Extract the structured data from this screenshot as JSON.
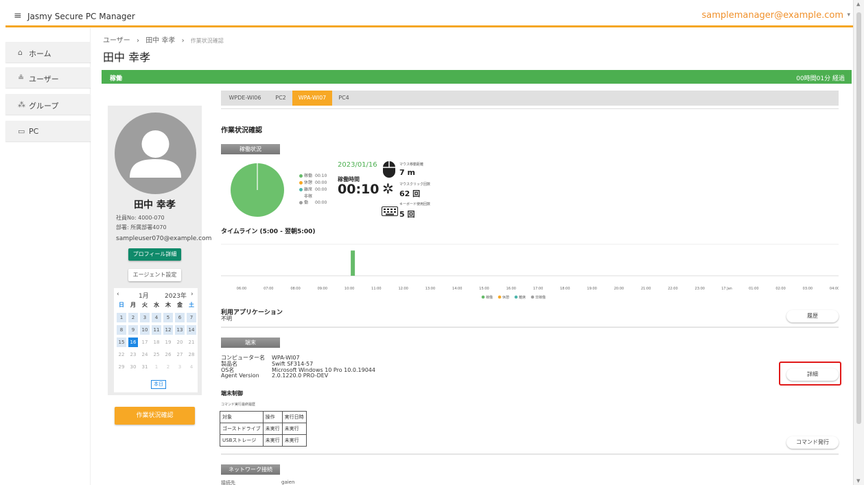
{
  "header": {
    "menu_icon": "hamburger-icon",
    "app_title": "Jasmy Secure PC Manager",
    "user_email": "samplemanager@example.com",
    "caret": "▾"
  },
  "sidebar": {
    "items": [
      {
        "icon": "home-icon",
        "label": "ホーム"
      },
      {
        "icon": "user-icon",
        "label": "ユーザー"
      },
      {
        "icon": "group-icon",
        "label": "グループ"
      },
      {
        "icon": "pc-icon",
        "label": "PC"
      }
    ]
  },
  "breadcrumb": {
    "root": "ユーザー",
    "sep": "›",
    "user": "田中 幸孝",
    "current": "作業状況確認"
  },
  "page_title": "田中 幸孝",
  "status": {
    "state": "稼働",
    "elapsed": "00時間01分 経過",
    "color": "#4caf50"
  },
  "profile": {
    "name": "田中 幸孝",
    "employee_no": "社員No: 4000-070",
    "department": "部署: 所属部署4070",
    "email": "sampleuser070@example.com",
    "profile_button": "プロフィール詳細",
    "agent_button": "エージェント設定"
  },
  "calendar": {
    "prev": "‹",
    "next": "›",
    "month": "1月",
    "year": "2023年",
    "dow": [
      "日",
      "月",
      "火",
      "水",
      "木",
      "金",
      "土"
    ],
    "weeks": [
      [
        "1",
        "2",
        "3",
        "4",
        "5",
        "6",
        "7"
      ],
      [
        "8",
        "9",
        "10",
        "11",
        "12",
        "13",
        "14"
      ],
      [
        "15",
        "16",
        "17",
        "18",
        "19",
        "20",
        "21"
      ],
      [
        "22",
        "23",
        "24",
        "25",
        "26",
        "27",
        "28"
      ],
      [
        "29",
        "30",
        "31",
        "1",
        "2",
        "3",
        "4"
      ]
    ],
    "today_label": "本日"
  },
  "work_status_button": "作業状況確認",
  "tabs": [
    "WPDE-WI06",
    "PC2",
    "WPA-WI07",
    "PC4"
  ],
  "active_tab": 2,
  "work": {
    "title": "作業状況確認",
    "operation_label": "稼働状況",
    "legend": [
      {
        "label": "稼働",
        "value": "00:10",
        "color": "#66bb6a"
      },
      {
        "label": "休憩",
        "value": "00:00",
        "color": "#f7a825"
      },
      {
        "label": "離席",
        "value": "00:00",
        "color": "#4db6ac"
      },
      {
        "label": "非稼働",
        "value": "00:00",
        "color": "#9e9e9e"
      }
    ],
    "date": "2023/01/16",
    "uptime_label": "稼働時間",
    "uptime": "00:10",
    "mouse_move_label": "マウス移動距離",
    "mouse_move": "7 m",
    "mouse_click_label": "マウスクリック回数",
    "mouse_click": "62 回",
    "keyboard_label": "キーボード使用回数",
    "keyboard": "5 回"
  },
  "chart_data": {
    "type": "bar",
    "title": "タイムライン (5:00 - 翌朝5:00)",
    "categories": [
      "06:00",
      "07:00",
      "08:00",
      "09:00",
      "10:00",
      "11:00",
      "12:00",
      "13:00",
      "14:00",
      "15:00",
      "16:00",
      "17:00",
      "18:00",
      "19:00",
      "20:00",
      "21:00",
      "22:00",
      "23:00",
      "17 Jan",
      "01:00",
      "02:00",
      "03:00",
      "04:00"
    ],
    "series": [
      {
        "name": "稼働",
        "values": [
          0,
          0,
          0,
          0,
          0.8,
          0,
          0,
          0,
          0,
          0,
          0,
          0,
          0,
          0,
          0,
          0,
          0,
          0,
          0,
          0,
          0,
          0,
          0
        ]
      },
      {
        "name": "休憩",
        "values": [
          0,
          0,
          0,
          0,
          0,
          0,
          0,
          0,
          0,
          0,
          0,
          0,
          0,
          0,
          0,
          0,
          0,
          0,
          0,
          0,
          0,
          0,
          0
        ]
      },
      {
        "name": "離席",
        "values": [
          0,
          0,
          0,
          0,
          0,
          0,
          0,
          0,
          0,
          0,
          0,
          0,
          0,
          0,
          0,
          0,
          0,
          0,
          0,
          0,
          0,
          0,
          0
        ]
      },
      {
        "name": "非稼働",
        "values": [
          0,
          0,
          0,
          0,
          0,
          0,
          0,
          0,
          0,
          0,
          0,
          0,
          0,
          0,
          0,
          0,
          0,
          0,
          0,
          0,
          0,
          0,
          0
        ]
      }
    ],
    "pie": [
      {
        "label": "稼働",
        "value": 100
      }
    ],
    "ylim": [
      0,
      1
    ]
  },
  "apps": {
    "title": "利用アプリケーション",
    "value": "不明",
    "history_button": "履歴"
  },
  "terminal": {
    "label": "端末",
    "rows": [
      {
        "key": "コンピューター名",
        "value": "WPA-WI07"
      },
      {
        "key": "製品名",
        "value": "Swift SF314-57"
      },
      {
        "key": "OS名",
        "value": "Microsoft Windows 10 Pro 10.0.19044"
      },
      {
        "key": "Agent Version",
        "value": "2.0.1220.0 PRO-DEV"
      }
    ],
    "detail_button": "詳細"
  },
  "control": {
    "title": "端末制御",
    "history_label": "コマンド実行最終履歴",
    "table": [
      [
        "対象",
        "操作",
        "実行日時"
      ],
      [
        "ゴーストドライブ",
        "未実行",
        "未実行"
      ],
      [
        "USBストレージ",
        "未実行",
        "未実行"
      ]
    ],
    "command_button": "コマンド発行"
  },
  "network": {
    "label": "ネットワーク接続",
    "row_key": "接続先",
    "row_value": "gaien"
  }
}
